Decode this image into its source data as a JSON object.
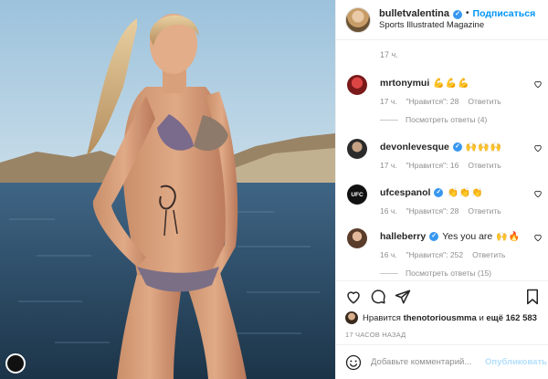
{
  "post": {
    "username": "bulletvalentina",
    "follow_label": "Подписаться",
    "separator": "•",
    "subtitle": "Sports Illustrated Magazine",
    "time": "17 ч."
  },
  "verified_glyph": "✓",
  "comments": [
    {
      "user": "mrtonymui",
      "text": "💪💪💪",
      "time": "17 ч.",
      "likes": "\"Нравится\": 28",
      "reply": "Ответить",
      "view_replies": "Посмотреть ответы (4)",
      "verified": false
    },
    {
      "user": "devonlevesque",
      "text": "🙌🙌🙌",
      "time": "17 ч.",
      "likes": "\"Нравится\": 16",
      "reply": "Ответить",
      "verified": true
    },
    {
      "user": "ufcespanol",
      "avatar_text": "UFC",
      "text": "👏👏👏",
      "time": "16 ч.",
      "likes": "\"Нравится\": 28",
      "reply": "Ответить",
      "verified": true
    },
    {
      "user": "halleberry",
      "text": "Yes you are",
      "emoji": "🙌🔥",
      "time": "16 ч.",
      "likes": "\"Нравится\": 252",
      "reply": "Ответить",
      "view_replies": "Посмотреть ответы (15)",
      "verified": true
    }
  ],
  "likes_line": {
    "prefix": "Нравится",
    "user": "thenotoriousmma",
    "middle": "и",
    "count": "ещё 162 583"
  },
  "posted_ago": "17 ЧАСОВ НАЗАД",
  "add_comment": {
    "placeholder": "Добавьте комментарий...",
    "publish_label": "Опубликовать"
  },
  "colors": {
    "accent": "#0095f6",
    "verified": "#3897f0",
    "publish_disabled": "#b2dffc",
    "muted": "#8e8e8e"
  },
  "icons": [
    "heart-icon",
    "comment-icon",
    "share-icon",
    "bookmark-icon",
    "smile-icon",
    "verified-icon"
  ]
}
